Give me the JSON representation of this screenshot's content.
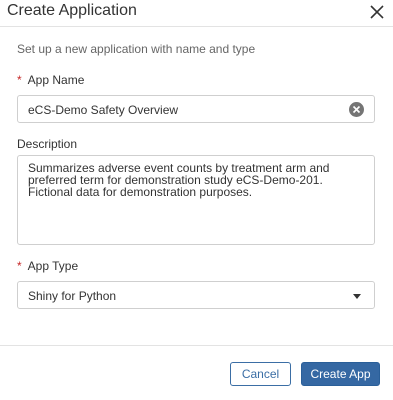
{
  "dialog": {
    "title": "Create Application",
    "subtitle": "Set up a new application with name and type"
  },
  "form": {
    "app_name": {
      "required_mark": "*",
      "label": "App Name",
      "value": "eCS-Demo Safety Overview"
    },
    "description": {
      "label": "Description",
      "line1": "Summarizes adverse event counts by treatment arm and",
      "line2": "preferred term for demonstration study eCS-Demo-201.",
      "line3": "Fictional data for demonstration purposes."
    },
    "app_type": {
      "required_mark": "*",
      "label": "App Type",
      "selected": "Shiny for Python"
    }
  },
  "footer": {
    "cancel_label": "Cancel",
    "create_label": "Create App"
  }
}
